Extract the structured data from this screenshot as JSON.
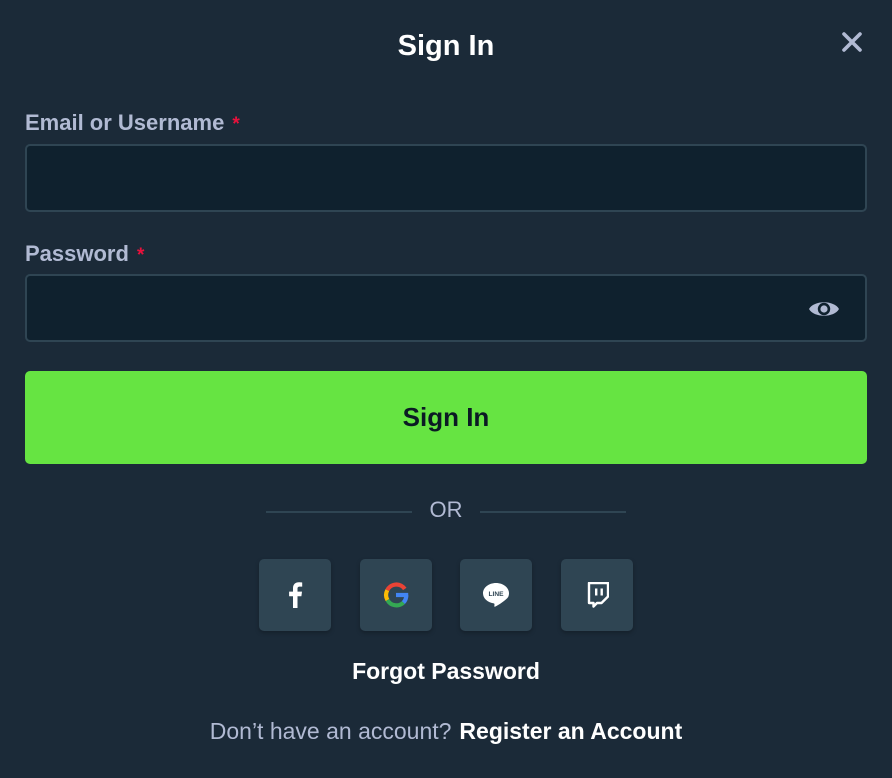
{
  "modal": {
    "title": "Sign In",
    "close_icon": "close-icon"
  },
  "form": {
    "email": {
      "label": "Email or Username",
      "required_mark": "*",
      "value": "",
      "placeholder": ""
    },
    "password": {
      "label": "Password",
      "required_mark": "*",
      "value": "",
      "placeholder": "",
      "toggle_icon": "eye-icon"
    },
    "submit_label": "Sign In"
  },
  "divider": {
    "text": "OR"
  },
  "social": [
    {
      "name": "facebook",
      "icon": "facebook-icon"
    },
    {
      "name": "google",
      "icon": "google-icon"
    },
    {
      "name": "line",
      "icon": "line-icon",
      "icon_text": "LINE"
    },
    {
      "name": "twitch",
      "icon": "twitch-icon"
    }
  ],
  "links": {
    "forgot_password": "Forgot Password",
    "no_account": "Don’t have an account?",
    "register": "Register an Account"
  },
  "colors": {
    "background": "#1b2a38",
    "input_background": "#0f212e",
    "input_border": "#2f4553",
    "accent": "#66e442",
    "label": "#b1bad3",
    "required": "#e9113c",
    "social_tile": "#2f4553"
  }
}
